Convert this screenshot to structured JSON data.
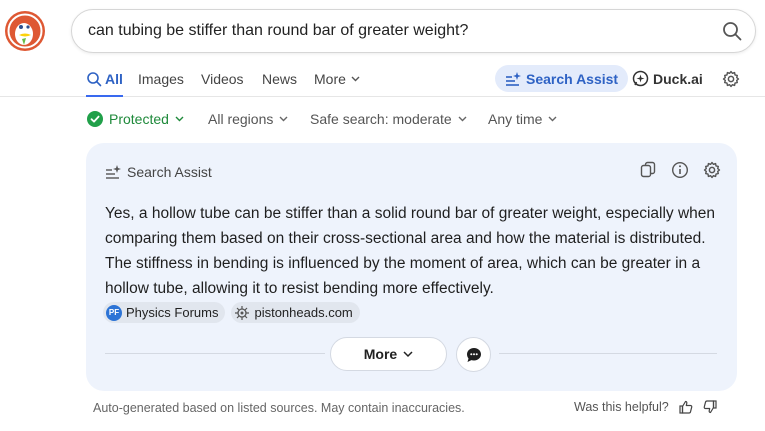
{
  "search": {
    "query": "can tubing be stiffer than round bar of greater weight?"
  },
  "tabs": [
    {
      "label": "All"
    },
    {
      "label": "Images"
    },
    {
      "label": "Videos"
    },
    {
      "label": "News"
    },
    {
      "label": "More"
    }
  ],
  "header_actions": {
    "search_assist": "Search Assist",
    "duck_ai": "Duck.ai"
  },
  "filters": {
    "protected": "Protected",
    "region": "All regions",
    "safe_search": "Safe search: moderate",
    "time": "Any time"
  },
  "assist": {
    "title": "Search Assist",
    "answer": "Yes, a hollow tube can be stiffer than a solid round bar of greater weight, especially when comparing them based on their cross-sectional area and how the material is distributed. The stiffness in bending is influenced by the moment of area, which can be greater in a hollow tube, allowing it to resist bending more effectively.",
    "sources": [
      {
        "label": "Physics Forums",
        "favicon_text": "PF"
      },
      {
        "label": "pistonheads.com"
      }
    ],
    "more_label": "More"
  },
  "footer": {
    "disclaimer": "Auto-generated based on listed sources. May contain inaccuracies.",
    "helpful": "Was this helpful?"
  },
  "colors": {
    "accent": "#3969ef",
    "protected_green": "#1f8a3b",
    "card_bg": "#eef3fc",
    "logo_orange": "#de5833"
  }
}
